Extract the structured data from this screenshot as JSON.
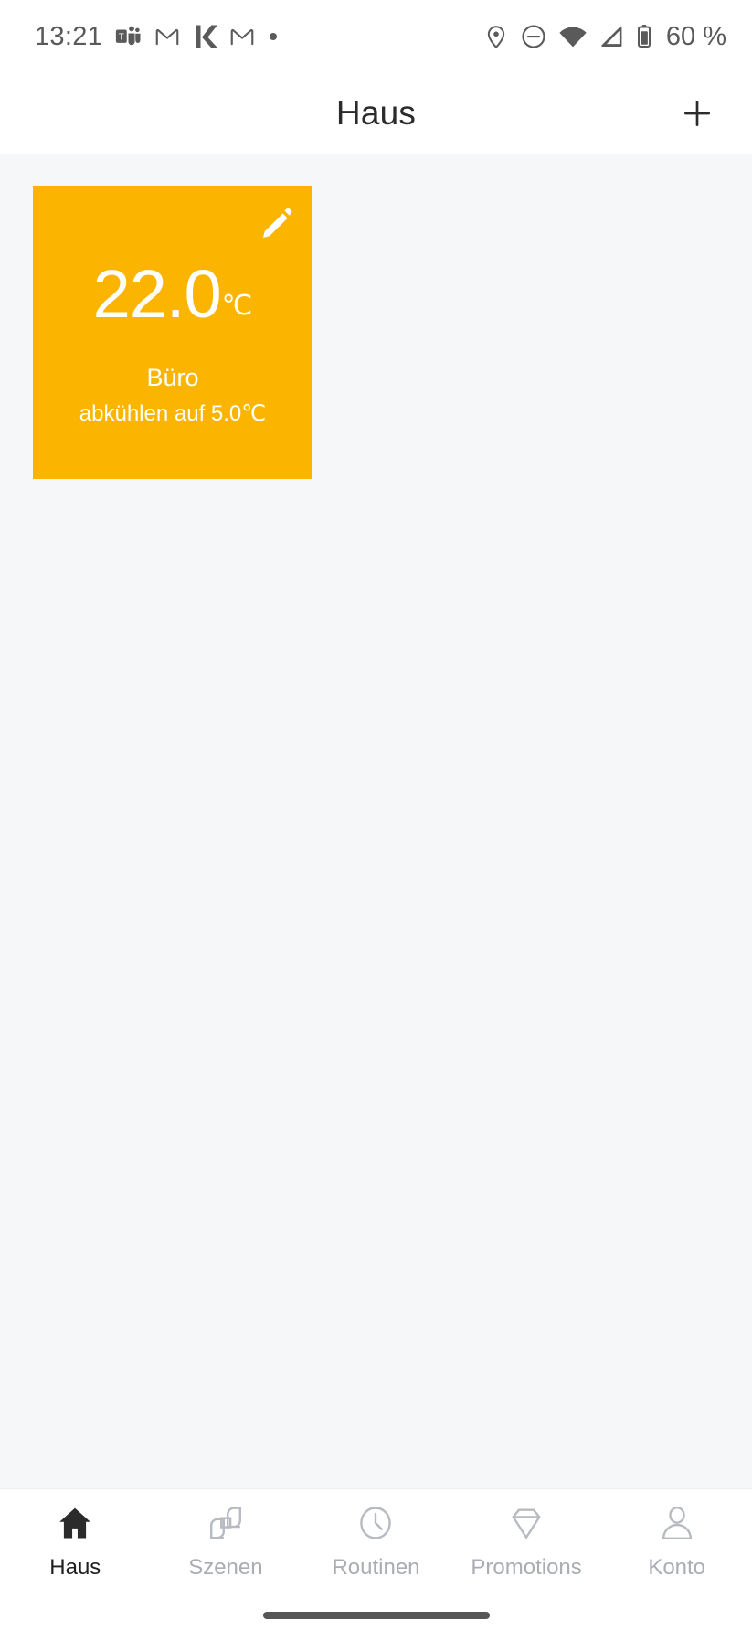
{
  "status_bar": {
    "time": "13:21",
    "battery_text": "60 %",
    "left_icons": [
      {
        "name": "teams-icon"
      },
      {
        "name": "gmail-icon"
      },
      {
        "name": "k-app-icon",
        "label": "k"
      },
      {
        "name": "gmail-icon-2"
      },
      {
        "name": "more-dot-icon"
      }
    ],
    "right_icons": [
      {
        "name": "location-icon"
      },
      {
        "name": "do-not-disturb-icon"
      },
      {
        "name": "wifi-icon"
      },
      {
        "name": "cellular-signal-icon"
      },
      {
        "name": "battery-icon"
      }
    ]
  },
  "header": {
    "title": "Haus",
    "add_button_label": "+"
  },
  "card": {
    "temperature": "22.0",
    "unit": "℃",
    "room_name": "Büro",
    "status_text": "abkühlen auf 5.0℃",
    "accent_color": "#fbb500",
    "edit_icon": "pencil-icon"
  },
  "bottom_nav": {
    "items": [
      {
        "label": "Haus",
        "icon": "home-icon",
        "active": true
      },
      {
        "label": "Szenen",
        "icon": "scenes-icon",
        "active": false
      },
      {
        "label": "Routinen",
        "icon": "clock-icon",
        "active": false
      },
      {
        "label": "Promotions",
        "icon": "diamond-icon",
        "active": false
      },
      {
        "label": "Konto",
        "icon": "person-icon",
        "active": false
      }
    ]
  },
  "colors": {
    "content_background": "#f6f7f9",
    "accent": "#fbb500",
    "nav_inactive": "#a9adb4",
    "nav_active": "#1f1f1f"
  }
}
